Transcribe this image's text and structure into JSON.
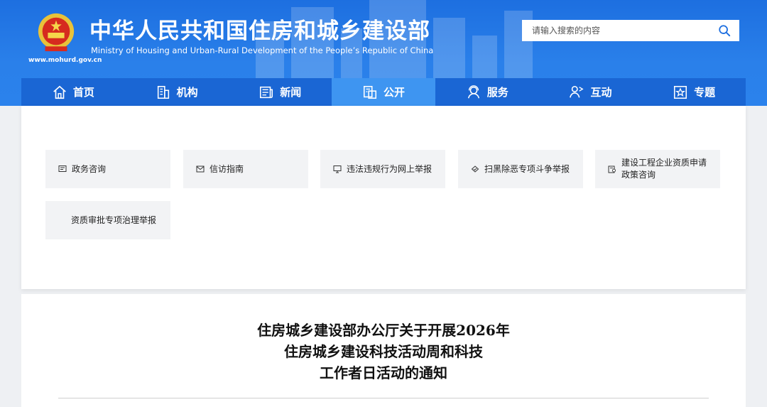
{
  "header": {
    "title": "中华人民共和国住房和城乡建设部",
    "subtitle": "Ministry of Housing and Urban-Rural Development of the People’s Republic of China",
    "url": "www.mohurd.gov.cn"
  },
  "search": {
    "placeholder": "请输入搜索的内容",
    "value": ""
  },
  "nav": [
    {
      "label": "首页",
      "icon": "home-icon"
    },
    {
      "label": "机构",
      "icon": "building-icon"
    },
    {
      "label": "新闻",
      "icon": "newspaper-icon"
    },
    {
      "label": "公开",
      "icon": "document-icon",
      "active": true
    },
    {
      "label": "服务",
      "icon": "service-person-icon"
    },
    {
      "label": "互动",
      "icon": "interaction-icon"
    },
    {
      "label": "专题",
      "icon": "star-topic-icon"
    }
  ],
  "quick_links": [
    {
      "label": "政务咨询",
      "icon": "message-icon"
    },
    {
      "label": "信访指南",
      "icon": "mail-icon"
    },
    {
      "label": "违法违规行为网上举报",
      "icon": "monitor-icon"
    },
    {
      "label": "扫黑除恶专项斗争举报",
      "icon": "shield-icon"
    },
    {
      "label": "建设工程企业资质申请政策咨询",
      "icon": "certificate-icon"
    },
    {
      "label": "资质审批专项治理举报",
      "icon": ""
    }
  ],
  "article": {
    "title_line1": "住房城乡建设部办公厅关于开展2026年",
    "title_line2": "住房城乡建设科技活动周和科技",
    "title_line3": "工作者日活动的通知"
  },
  "colors": {
    "header_blue": "#2a80ea",
    "nav_blue": "#1a66d4",
    "nav_active": "#3e95f1"
  }
}
